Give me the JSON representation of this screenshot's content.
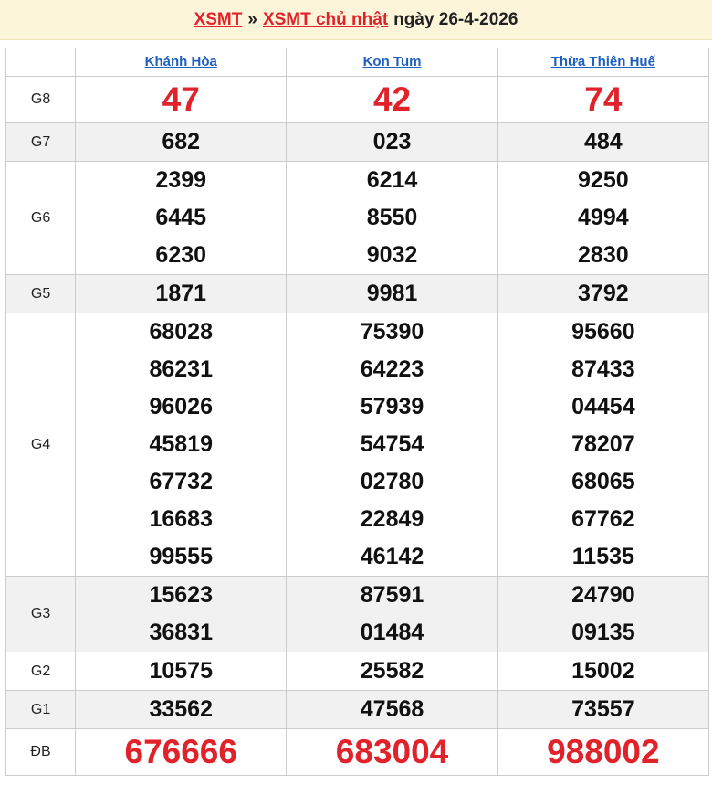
{
  "header": {
    "link1": "XSMT",
    "separator": "»",
    "link2": "XSMT chủ nhật",
    "date_text": "ngày 26-4-2026"
  },
  "provinces": [
    "Khánh Hòa",
    "Kon Tum",
    "Thừa Thiên Huế"
  ],
  "prizes": [
    {
      "label": "G8",
      "style": "big",
      "values": [
        [
          "47"
        ],
        [
          "42"
        ],
        [
          "74"
        ]
      ]
    },
    {
      "label": "G7",
      "style": "num",
      "values": [
        [
          "682"
        ],
        [
          "023"
        ],
        [
          "484"
        ]
      ]
    },
    {
      "label": "G6",
      "style": "num",
      "values": [
        [
          "2399",
          "6445",
          "6230"
        ],
        [
          "6214",
          "8550",
          "9032"
        ],
        [
          "9250",
          "4994",
          "2830"
        ]
      ]
    },
    {
      "label": "G5",
      "style": "num",
      "values": [
        [
          "1871"
        ],
        [
          "9981"
        ],
        [
          "3792"
        ]
      ]
    },
    {
      "label": "G4",
      "style": "num",
      "values": [
        [
          "68028",
          "86231",
          "96026",
          "45819",
          "67732",
          "16683",
          "99555"
        ],
        [
          "75390",
          "64223",
          "57939",
          "54754",
          "02780",
          "22849",
          "46142"
        ],
        [
          "95660",
          "87433",
          "04454",
          "78207",
          "68065",
          "67762",
          "11535"
        ]
      ]
    },
    {
      "label": "G3",
      "style": "num",
      "values": [
        [
          "15623",
          "36831"
        ],
        [
          "87591",
          "01484"
        ],
        [
          "24790",
          "09135"
        ]
      ]
    },
    {
      "label": "G2",
      "style": "num",
      "values": [
        [
          "10575"
        ],
        [
          "25582"
        ],
        [
          "15002"
        ]
      ]
    },
    {
      "label": "G1",
      "style": "num",
      "values": [
        [
          "33562"
        ],
        [
          "47568"
        ],
        [
          "73557"
        ]
      ]
    },
    {
      "label": "ĐB",
      "style": "db",
      "values": [
        [
          "676666"
        ],
        [
          "683004"
        ],
        [
          "988002"
        ]
      ]
    }
  ],
  "colors": {
    "accent_red": "#e0222a",
    "link_blue": "#1f5fbf",
    "header_bg": "#fdf5d9",
    "alt_row_bg": "#f1f1f1"
  }
}
